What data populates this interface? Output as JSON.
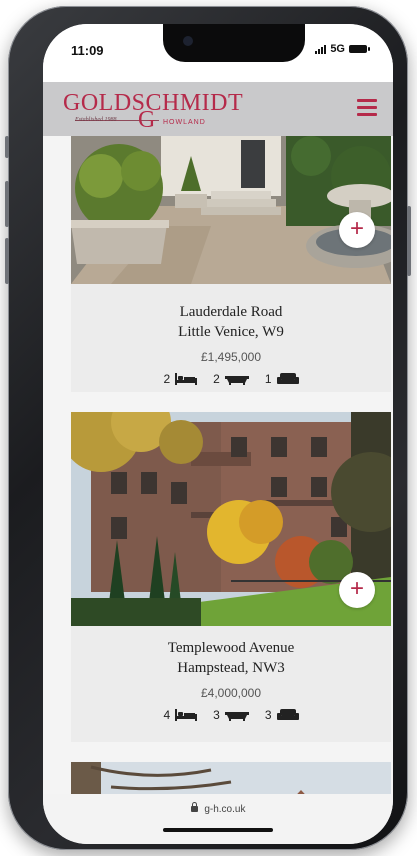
{
  "status_bar": {
    "time": "11:09",
    "network": "5G"
  },
  "brand": {
    "name_main": "GOLDSCHMIDT",
    "name_second": "HOWLAND",
    "initial": "G",
    "established": "Established 1988",
    "accent_color": "#b52a4a"
  },
  "menu": {
    "icon": "hamburger-menu-icon"
  },
  "listings": [
    {
      "street": "Lauderdale Road",
      "area": "Little Venice, W9",
      "price": "£1,495,000",
      "bedrooms": "2",
      "bathrooms": "2",
      "receptions": "1"
    },
    {
      "street": "Templewood Avenue",
      "area": "Hampstead, NW3",
      "price": "£4,000,000",
      "bedrooms": "4",
      "bathrooms": "3",
      "receptions": "3"
    }
  ],
  "browser": {
    "url": "g-h.co.uk"
  }
}
